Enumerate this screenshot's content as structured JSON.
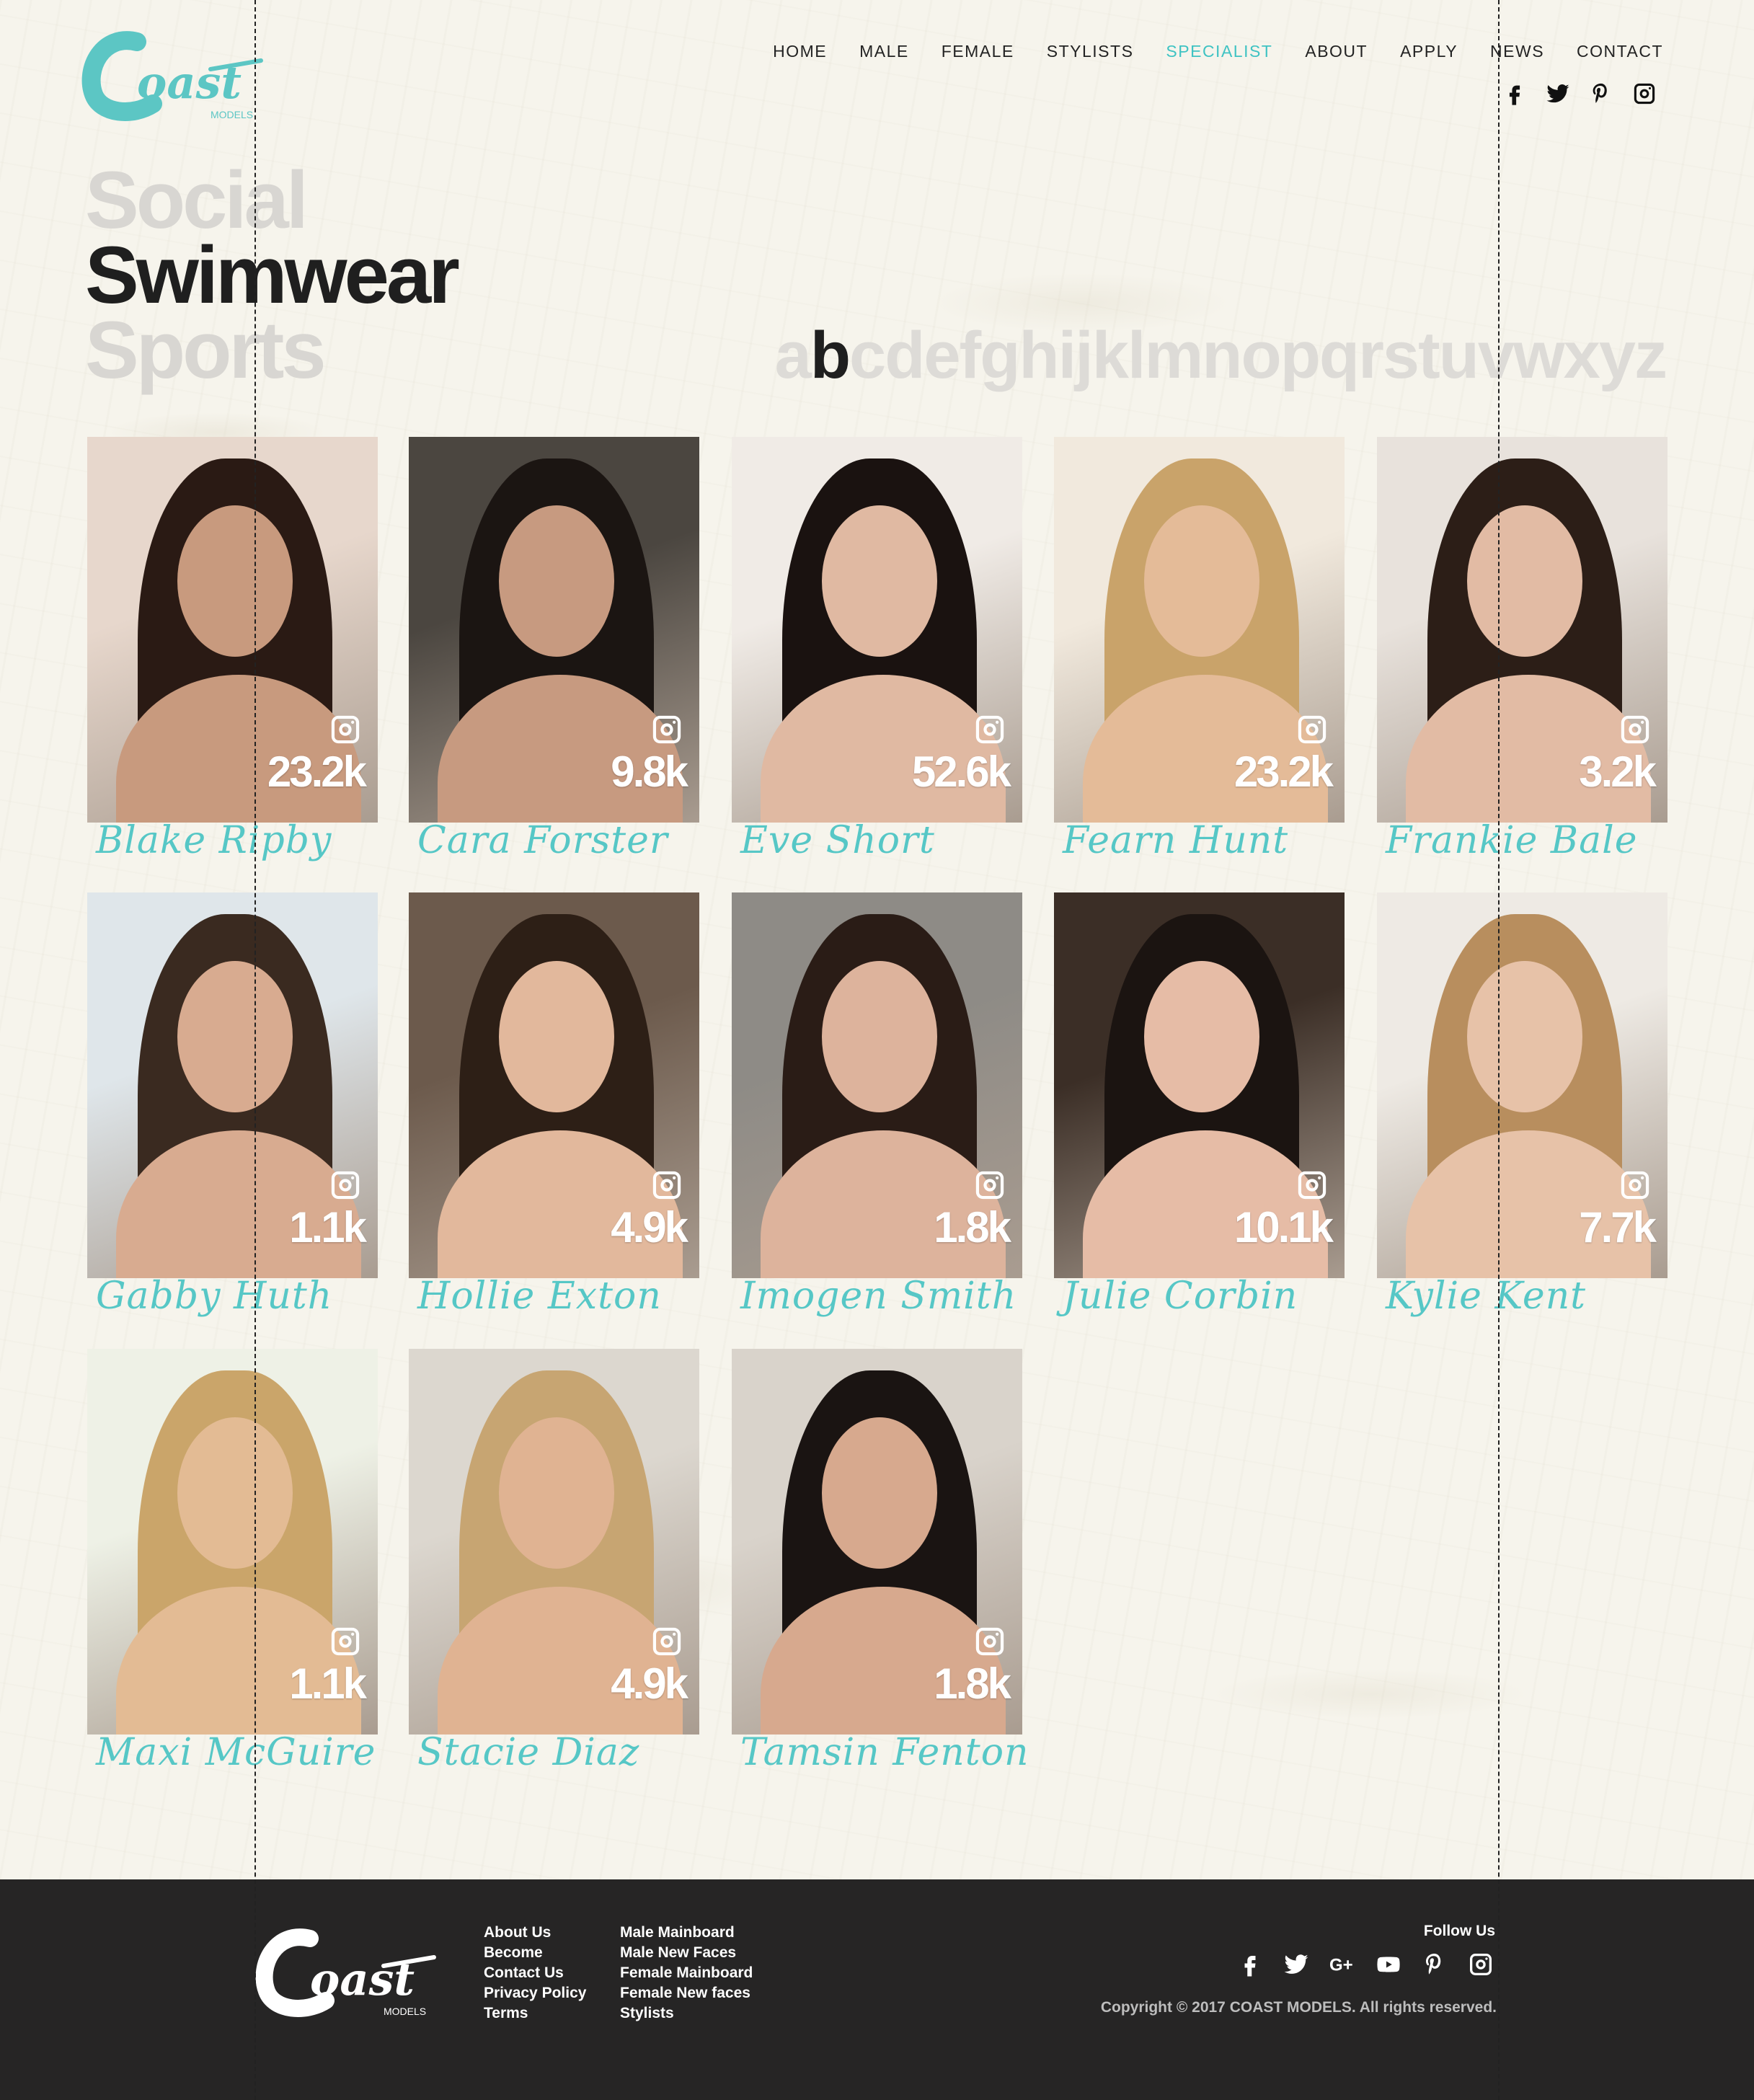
{
  "brand": {
    "name": "Coast",
    "sub": "MODELS",
    "accent": "#3fc3c3"
  },
  "nav": [
    "HOME",
    "MALE",
    "FEMALE",
    "STYLISTS",
    "SPECIALIST",
    "ABOUT",
    "APPLY",
    "NEWS",
    "CONTACT"
  ],
  "nav_active": "SPECIALIST",
  "social_top": [
    "facebook-icon",
    "twitter-icon",
    "pinterest-icon",
    "instagram-icon"
  ],
  "categories": [
    {
      "label": "Social",
      "active": false
    },
    {
      "label": "Swimwear",
      "active": true
    },
    {
      "label": "Sports",
      "active": false
    }
  ],
  "alphabet": [
    "a",
    "b",
    "c",
    "d",
    "e",
    "f",
    "g",
    "h",
    "i",
    "j",
    "k",
    "l",
    "m",
    "n",
    "o",
    "p",
    "q",
    "r",
    "s",
    "t",
    "u",
    "v",
    "w",
    "x",
    "y",
    "z"
  ],
  "alphabet_active": "b",
  "models": [
    {
      "name": "Blake Ripby",
      "followers": "23.2k"
    },
    {
      "name": "Cara Forster",
      "followers": "9.8k"
    },
    {
      "name": "Eve Short",
      "followers": "52.6k"
    },
    {
      "name": "Fearn Hunt",
      "followers": "23.2k"
    },
    {
      "name": "Frankie Bale",
      "followers": "3.2k"
    },
    {
      "name": "Gabby Huth",
      "followers": "1.1k"
    },
    {
      "name": "Hollie Exton",
      "followers": "4.9k"
    },
    {
      "name": "Imogen Smith",
      "followers": "1.8k"
    },
    {
      "name": "Julie Corbin",
      "followers": "10.1k"
    },
    {
      "name": "Kylie Kent",
      "followers": "7.7k"
    },
    {
      "name": "Maxi McGuire",
      "followers": "1.1k"
    },
    {
      "name": "Stacie Diaz",
      "followers": "4.9k"
    },
    {
      "name": "Tamsin Fenton",
      "followers": "1.8k"
    }
  ],
  "footer": {
    "links_col1": [
      "About Us",
      "Become",
      "Contact Us",
      "Privacy Policy",
      "Terms"
    ],
    "links_col2": [
      "Male Mainboard",
      "Male New Faces",
      "Female Mainboard",
      "Female New faces",
      "Stylists"
    ],
    "follow_label": "Follow Us",
    "social": [
      "facebook-icon",
      "twitter-icon",
      "google-plus-icon",
      "youtube-icon",
      "pinterest-icon",
      "instagram-icon"
    ],
    "copyright": "Copyright © 2017 COAST MODELS. All rights reserved."
  }
}
